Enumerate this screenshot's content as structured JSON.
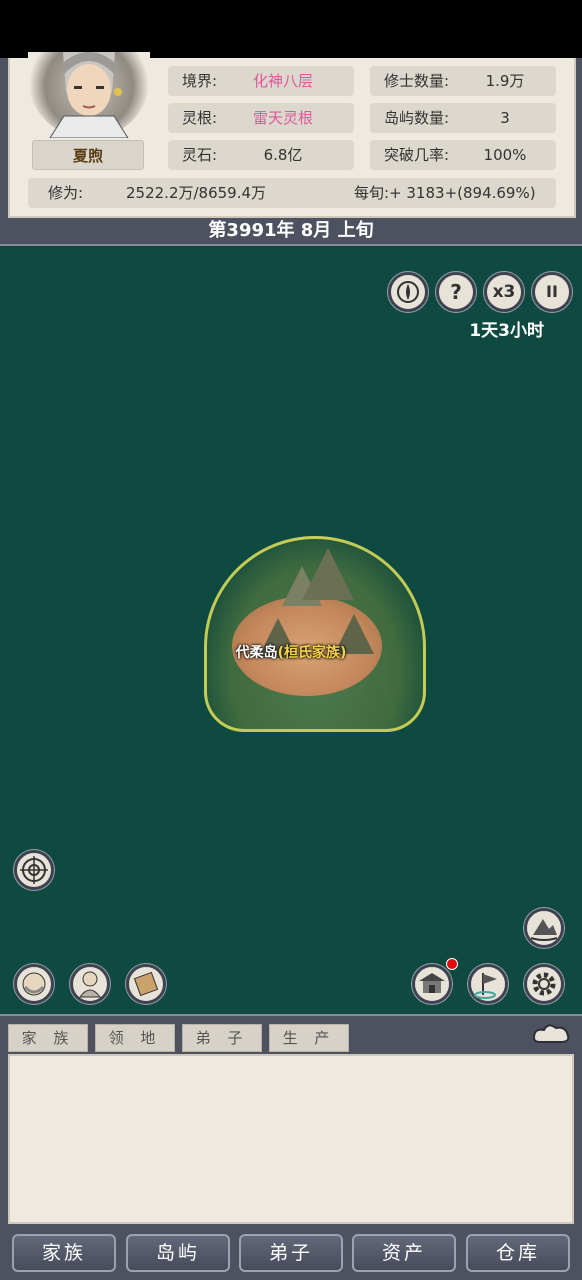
{
  "character": {
    "name": "夏煦"
  },
  "stats": {
    "realm_label": "境界:",
    "realm_value": "化神八层",
    "root_label": "灵根:",
    "root_value": "雷天灵根",
    "stone_label": "灵石:",
    "stone_value": "6.8亿",
    "cultivators_label": "修士数量:",
    "cultivators_value": "1.9万",
    "islands_label": "岛屿数量:",
    "islands_value": "3",
    "breakthrough_label": "突破几率:",
    "breakthrough_value": "100%",
    "cultivation_label": "修为:",
    "cultivation_value": "2522.2万/8659.4万",
    "per_period": "每旬:+ 3183+(894.69%)"
  },
  "date": "第3991年 8月 上旬",
  "map": {
    "help_label": "?",
    "speed_label": "x3",
    "pause_label": "II",
    "timer": "1天3小时",
    "island_name": "代柔岛",
    "island_open": "(",
    "island_clan": "桓氏家族",
    "island_close": ")"
  },
  "log_tabs": [
    "家 族",
    "领 地",
    "弟 子",
    "生 产"
  ],
  "nav": [
    "家族",
    "岛屿",
    "弟子",
    "资产",
    "仓库"
  ],
  "colors": {
    "accent_pink": "#e0569b",
    "map_sea": "#0e4a40",
    "notification": "#e20e0e"
  }
}
